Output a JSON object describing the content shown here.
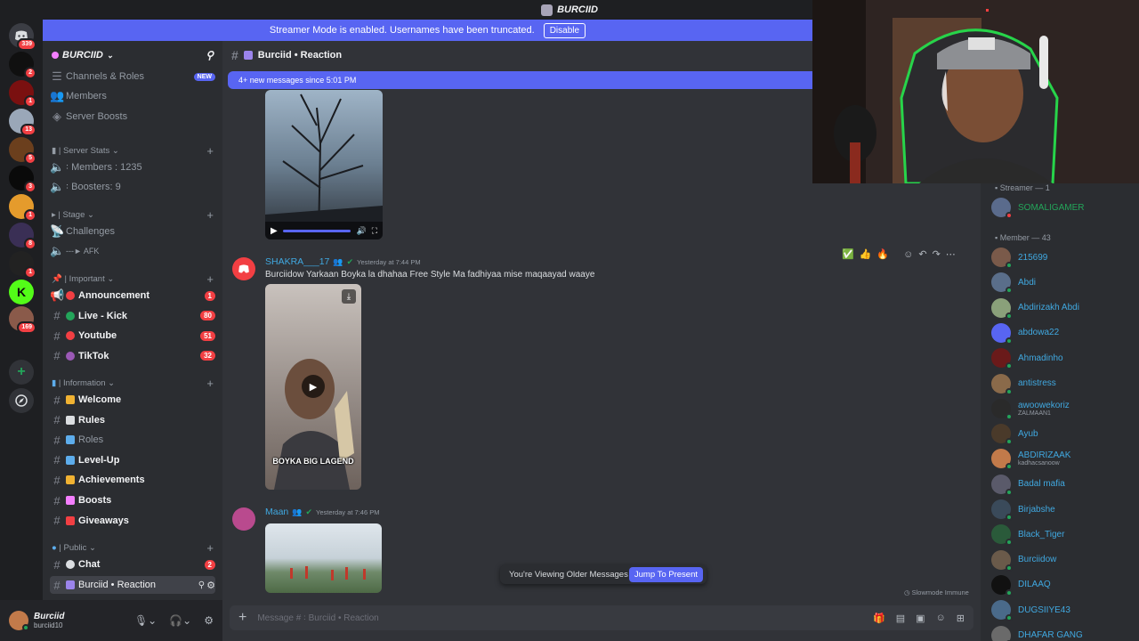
{
  "window": {
    "title": "BURCIID"
  },
  "notice": {
    "text": "Streamer Mode is enabled. Usernames have been truncated.",
    "button": "Disable"
  },
  "rail": {
    "servers": [
      {
        "label": "",
        "badge": "339",
        "color": "#3b3d44"
      },
      {
        "label": "",
        "badge": "2",
        "color": "#101010"
      },
      {
        "label": "",
        "badge": "1",
        "color": "#7a1010"
      },
      {
        "label": "",
        "badge": "13",
        "color": "#9aa7b8"
      },
      {
        "label": "",
        "badge": "5",
        "color": "#6b3f1d"
      },
      {
        "label": "",
        "badge": "3",
        "color": "#0a0a0a"
      },
      {
        "label": "",
        "badge": "1",
        "color": "#e59b2c"
      },
      {
        "label": "",
        "badge": "8",
        "color": "#3a2f55"
      },
      {
        "label": "",
        "badge": "1",
        "color": "#222"
      },
      {
        "label": "K",
        "badge": "",
        "color": "#53fc18"
      },
      {
        "label": "",
        "badge": "169",
        "color": "#8a5a4a"
      }
    ]
  },
  "server": {
    "name": "BURCIID"
  },
  "sidebar": {
    "top_items": [
      {
        "label": "Channels & Roles",
        "tag": "NEW"
      },
      {
        "label": "Members",
        "tag": ""
      },
      {
        "label": "Server Boosts",
        "tag": ""
      }
    ],
    "categories": {
      "server_stats": "| Server Stats",
      "stage": "| Stage",
      "important": "| Important",
      "information": "| Information",
      "public": "| Public"
    },
    "stats": [
      {
        "label": "꞉ Members : 1235"
      },
      {
        "label": "꞉ Boosters: 9"
      }
    ],
    "stage_items": [
      {
        "label": "Challenges"
      },
      {
        "label": "---► AFK"
      }
    ],
    "important_channels": [
      {
        "label": "Announcement",
        "count": "1",
        "dot": "#f23f43"
      },
      {
        "label": "Live - Kick",
        "count": "80",
        "dot": "#23a55a"
      },
      {
        "label": "Youtube",
        "count": "51",
        "dot": "#f23f43"
      },
      {
        "label": "TikTok",
        "count": "32",
        "dot": "#9b59b6"
      }
    ],
    "info_channels": [
      {
        "label": "Welcome",
        "dot": "#f0b232",
        "bright": true
      },
      {
        "label": "Rules",
        "dot": "#dbdee1",
        "bright": true
      },
      {
        "label": "Roles",
        "dot": "#5dadec",
        "bright": false
      },
      {
        "label": "Level-Up",
        "dot": "#5dadec",
        "bright": true
      },
      {
        "label": "Achievements",
        "dot": "#f0b232",
        "bright": true
      },
      {
        "label": "Boosts",
        "dot": "#f47fff",
        "bright": true
      },
      {
        "label": "Giveaways",
        "dot": "#f23f43",
        "bright": true
      }
    ],
    "public_channels": [
      {
        "label": "Chat",
        "count": "2"
      },
      {
        "label": "Burciid • Reaction",
        "count": ""
      }
    ]
  },
  "user": {
    "name": "Burciid",
    "tag": "burciid10"
  },
  "channel": {
    "name": "Burciid • Reaction"
  },
  "new_messages_bar": "4+ new messages since 5:01 PM",
  "messages": [
    {
      "author": "SHAKRA___17",
      "time": "Yesterday at 7:44 PM",
      "text": "Burciidow Yarkaan Boyka la dhahaa Free Style Ma fadhiyaa mise maqaayad waaye",
      "video_caption": "BOYKA BIG LAGEND",
      "author_color": "#40a8e0"
    },
    {
      "author": "Maan",
      "time": "Yesterday at 7:46 PM",
      "author_color": "#40a8e0"
    }
  ],
  "older_banner": {
    "text": "You're Viewing Older Messages",
    "button": "Jump To Present"
  },
  "slowmode": "Slowmode Immune",
  "composer": {
    "placeholder": "Message # ꞉ Burciid • Reaction"
  },
  "members": {
    "streamer_header": "Streamer — 1",
    "member_header": "Member — 43",
    "streamers": [
      {
        "name": "SOMALIGAMER",
        "color": "#23a55a"
      }
    ],
    "list": [
      {
        "name": "215699",
        "sub": ""
      },
      {
        "name": "Abdi",
        "sub": ""
      },
      {
        "name": "Abdirizakh Abdi",
        "sub": ""
      },
      {
        "name": "abdowa22",
        "sub": ""
      },
      {
        "name": "Ahmadinho",
        "sub": ""
      },
      {
        "name": "antistress",
        "sub": ""
      },
      {
        "name": "awoowekoriz",
        "sub": "ZALMAAN1"
      },
      {
        "name": "Ayub",
        "sub": ""
      },
      {
        "name": "ABDIRIZAAK",
        "sub": "kadhacsanoow"
      },
      {
        "name": "Badal mafia",
        "sub": ""
      },
      {
        "name": "Birjabshe",
        "sub": ""
      },
      {
        "name": "Black_Tiger",
        "sub": ""
      },
      {
        "name": "Burciidow",
        "sub": ""
      },
      {
        "name": "DILAAQ",
        "sub": ""
      },
      {
        "name": "DUGSIIYE43",
        "sub": ""
      },
      {
        "name": "DHAFAR GANG",
        "sub": ""
      }
    ]
  },
  "icons": {
    "stats": "speaker-icon",
    "play": "play-icon",
    "download": "download-icon",
    "add": "plus-icon"
  }
}
